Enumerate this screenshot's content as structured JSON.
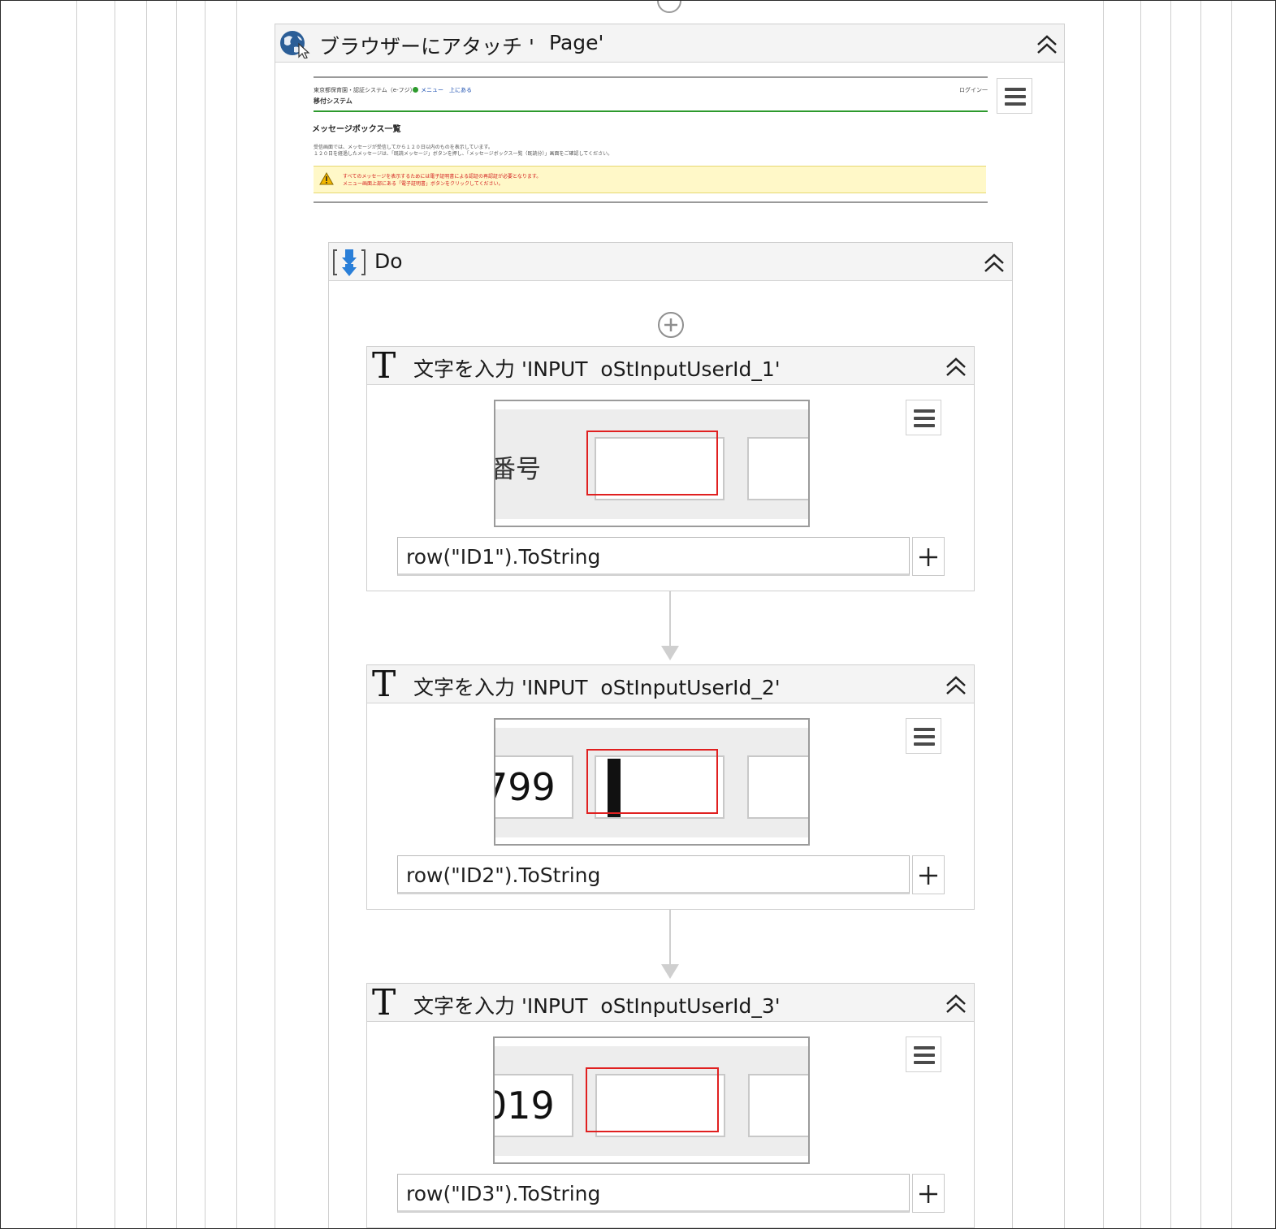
{
  "attach": {
    "title_prefix": "ブラウザーにアタッチ '",
    "title_suffix": "Page'"
  },
  "browser_preview": {
    "header_text": "東京都保育園・認証システム（e-フジ）",
    "header_links": "メニュー　上にある",
    "login_text": "ログイン一",
    "system_name": "移付システム",
    "page_heading": "メッセージボックス一覧",
    "desc_line1": "受信画面では、メッセージが受信してから１２０日以内のものを表示しています。",
    "desc_line2": "１２０日を経過したメッセージは、「既読メッセージ」ボタンを押し、「メッセージボックス一覧（既読分）」画面をご確認してください。",
    "warning_line1": "すべてのメッセージを表示するためには電子証明書による認証の再認証が必要となります。",
    "warning_line2": "メニュー画面上部にある「電子証明書」ボタンをクリックしてください。"
  },
  "do_block": {
    "title": "Do"
  },
  "type_activities": [
    {
      "title": "文字を入力 'INPUT  oStInputUserId_1'",
      "preview_label": "番号",
      "expression": "row(\"ID1\").ToString"
    },
    {
      "title": "文字を入力 'INPUT  oStInputUserId_2'",
      "preview_label": "799",
      "expression": "row(\"ID2\").ToString"
    },
    {
      "title": "文字を入力 'INPUT  oStInputUserId_3'",
      "preview_label": "019",
      "expression": "row(\"ID3\").ToString"
    }
  ],
  "icons": {
    "attach": "globe-cursor-icon",
    "do": "sequence-down-icon",
    "type_into": "T-type-into-icon",
    "collapse": "double-chevron-up-icon",
    "menu": "hamburger-menu-icon",
    "add": "plus-icon",
    "insert": "circle-plus-icon"
  },
  "colors": {
    "selection_border": "#e02020",
    "warning_bg": "#fff8c8",
    "green_rule": "#2d9a2d"
  }
}
